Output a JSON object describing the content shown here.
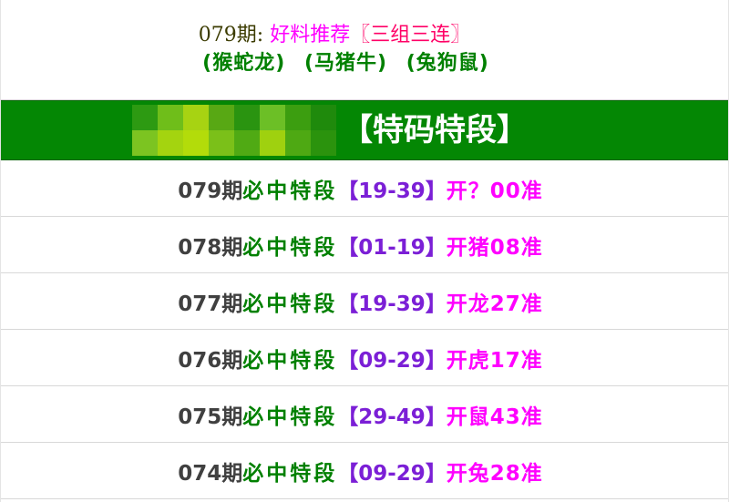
{
  "top": {
    "issue": "079期:",
    "pick_label": "好料推荐",
    "pick_value": "〖三组三连〗",
    "groups": [
      "(猴蛇龙)",
      "(马猪牛)",
      "(兔狗鼠)"
    ]
  },
  "banner": {
    "title": "【特码特段】",
    "blur_colors": [
      "#2d9a12",
      "#6fbe1a",
      "#a7d312",
      "#58a814",
      "#2a9410",
      "#6cbf26",
      "#3c9e10",
      "#1f8a0c",
      "#7cc421",
      "#a4d40f",
      "#b3dc0a",
      "#7bc019",
      "#50aa14",
      "#9fd10f",
      "#4ea913",
      "#2b930d"
    ]
  },
  "rows": [
    {
      "issue": "079期",
      "label": "必中特段",
      "range": "【19-39】",
      "result": "开？00准"
    },
    {
      "issue": "078期",
      "label": "必中特段",
      "range": "【01-19】",
      "result": "开猪08准"
    },
    {
      "issue": "077期",
      "label": "必中特段",
      "range": "【19-39】",
      "result": "开龙27准"
    },
    {
      "issue": "076期",
      "label": "必中特段",
      "range": "【09-29】",
      "result": "开虎17准"
    },
    {
      "issue": "075期",
      "label": "必中特段",
      "range": "【29-49】",
      "result": "开鼠43准"
    },
    {
      "issue": "074期",
      "label": "必中特段",
      "range": "【09-29】",
      "result": "开兔28准"
    }
  ]
}
